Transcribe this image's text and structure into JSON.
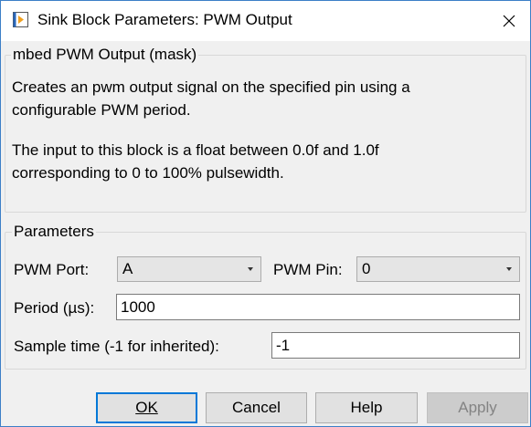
{
  "window": {
    "title": "Sink Block Parameters: PWM Output",
    "icon": "simulink-block-icon",
    "close_icon": "close-icon"
  },
  "mask": {
    "group_title": "mbed PWM Output (mask)",
    "description_lines": [
      "Creates an pwm output signal on the specified pin using a",
      "configurable PWM period.",
      "",
      "The input to this block is a float between 0.0f and 1.0f",
      "corresponding to 0 to 100% pulsewidth."
    ]
  },
  "parameters": {
    "group_title": "Parameters",
    "pwm_port": {
      "label": "PWM Port:",
      "value": "A"
    },
    "pwm_pin": {
      "label": "PWM Pin:",
      "value": "0"
    },
    "period": {
      "label": "Period (µs):",
      "value": "1000"
    },
    "sample_time": {
      "label": "Sample time (-1 for inherited):",
      "value": "-1"
    }
  },
  "buttons": {
    "ok": "OK",
    "cancel": "Cancel",
    "help": "Help",
    "apply": "Apply"
  },
  "colors": {
    "window_border": "#3c7fc7",
    "default_button_border": "#0078d7",
    "disabled_text": "#838383"
  }
}
